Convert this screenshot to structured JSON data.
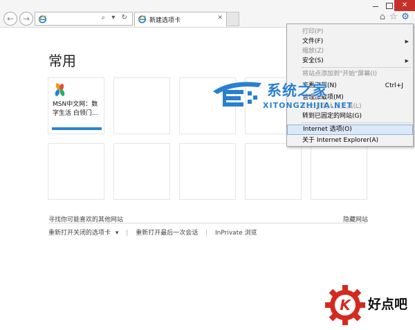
{
  "window": {
    "minimize_glyph": "",
    "close_glyph": "✕",
    "icons": [
      "minimize-icon",
      "maximize-icon",
      "close-icon"
    ]
  },
  "navigation": {
    "back_glyph": "←",
    "forward_glyph": "→",
    "address_value": "",
    "address_tools": "⌕ ▾ ↻"
  },
  "tab": {
    "label": "新建选项卡",
    "close_glyph": "✕"
  },
  "command_icons": {
    "home_glyph": "⌂",
    "favorites_glyph": "☆",
    "tools_glyph": "⚙"
  },
  "page": {
    "heading": "常用",
    "tiles": [
      {
        "text": "MSN中文网：数字生活 白领门...",
        "has_logo": true
      },
      {
        "text": ""
      },
      {
        "text": ""
      },
      {
        "text": ""
      },
      {
        "text": ""
      },
      {
        "text": ""
      },
      {
        "text": ""
      },
      {
        "text": ""
      },
      {
        "text": ""
      },
      {
        "text": ""
      }
    ],
    "find_link": "寻找你可能喜欢的其他网站",
    "hide_link": "隐藏网站",
    "bottom_links": {
      "reopen_closed_tabs": "重新打开关闭的选项卡",
      "reopen_closed_tabs_arrow": "▾",
      "reopen_last_session": "重新打开最后一次会话",
      "inprivate": "InPrivate 浏览",
      "separator": "|"
    }
  },
  "tools_menu": {
    "print": "打印(P)",
    "file": "文件(F)",
    "zoom": "缩放(Z)",
    "safety": "安全(S)",
    "add_to_start": "将站点添加到\"开始\"屏幕(I)",
    "downloads": "查看下载(N)",
    "downloads_shortcut": "Ctrl+J",
    "addons": "管理加载项(M)",
    "f12": "F12 开发人员工具(L)",
    "pinned_sites": "转到已固定的网站(G)",
    "internet_options": "Internet 选项(O)",
    "about": "关于 Internet Explorer(A)",
    "submenu_arrow": "▶"
  },
  "watermark": {
    "title": "系统之家",
    "url": "XITONGZHIJIA.NET",
    "badge_text": "好点吧",
    "badge_letter": "K"
  },
  "colors": {
    "accent": "#2a85d1",
    "close_button": "#c7302a",
    "menu_highlight": "#dbe8f7",
    "watermark_blue": "#2a7fcf",
    "badge_red": "#d42a1e"
  }
}
